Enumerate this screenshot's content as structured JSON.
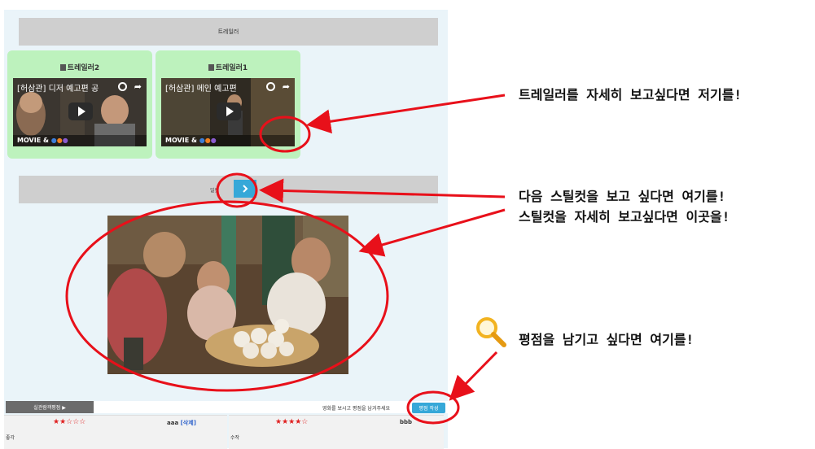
{
  "trailer_header": "트레일러",
  "trailers": [
    {
      "title": "트레일러2",
      "video_title": "[허삼관] 디저 예고편 공",
      "brand": "MOVIE &"
    },
    {
      "title": "트레일러1",
      "video_title": "[허삼관] 메인 예고편",
      "brand": "MOVIE &"
    }
  ],
  "still_label": "일컷",
  "next_icon": "chevron-right-icon",
  "rating_tab": "실관람객평점 ▶",
  "rating_hint": "영화를 보시고 평점을 남겨주세요",
  "rating_button": "평점 작성",
  "reviews": [
    {
      "stars": "★★☆☆☆",
      "user": "aaa",
      "delete_label": "[삭제]",
      "text": "좋각"
    },
    {
      "stars": "★★★★☆",
      "user": "bbb",
      "delete_label": "",
      "text": "수작"
    }
  ],
  "annotations": {
    "trailer_note": "트레일러를 자세히 보고싶다면 저기를!",
    "still_next_note": "다음 스틸컷을 보고 싶다면 여기를!",
    "still_detail_note": "스틸컷을 자세히 보고싶다면 이곳을!",
    "rating_note": "평점을 남기고 싶다면 여기를!"
  },
  "colors": {
    "accent": "#36a8d8",
    "annotation": "#e8101a",
    "card": "#bdf2bd",
    "panel": "#eaf4f9"
  }
}
